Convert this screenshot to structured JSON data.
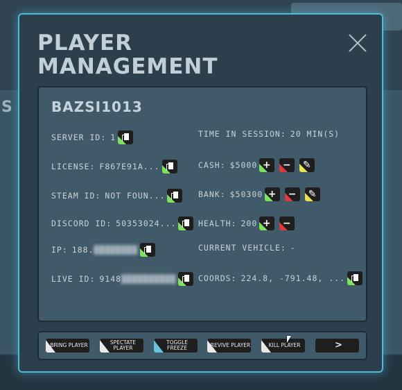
{
  "modal": {
    "title_line1": "PLAYER",
    "title_line2": "MANAGEMENT"
  },
  "background": {
    "left_letter": "S"
  },
  "player": {
    "name": "BAZSI1013",
    "left_fields": [
      {
        "label": "SERVER ID:",
        "value": "1",
        "blurred": false
      },
      {
        "label": "LICENSE:",
        "value": "F867E91A...",
        "blurred": false
      },
      {
        "label": "STEAM ID:",
        "value": "NOT FOUN...",
        "blurred": false
      },
      {
        "label": "DISCORD ID:",
        "value": "50353024...",
        "blurred": false
      },
      {
        "label": "IP:",
        "value": "188.",
        "blurred_value": "████████",
        "blurred": true
      },
      {
        "label": "LIVE ID:",
        "value": "9148",
        "blurred_value": "██████████",
        "blurred": true
      }
    ],
    "right_fields": {
      "time_label": "TIME IN SESSION:",
      "time_value": "20 MIN(S)",
      "cash_label": "CASH:",
      "cash_value": "$5000",
      "bank_label": "BANK:",
      "bank_value": "$50300",
      "health_label": "HEALTH:",
      "health_value": "200",
      "vehicle_label": "CURRENT VEHICLE:",
      "vehicle_value": "-",
      "coords_label": "COORDS:",
      "coords_value": "224.8, -791.48, ..."
    }
  },
  "icons": {
    "plus": "+",
    "minus": "−",
    "edit": "✎"
  },
  "actions": [
    {
      "label": "BRING PLAYER",
      "accent": "#7ee25c"
    },
    {
      "label": "SPECTATE PLAYER",
      "accent": "#7ee25c"
    },
    {
      "label": "TOGGLE FREEZE",
      "accent": "#63c4dc"
    },
    {
      "label": "REVIVE PLAYER",
      "accent": "#7ee25c"
    },
    {
      "label": "KILL PLAYER",
      "accent": "#e0383c"
    },
    {
      "label": ">",
      "accent": ""
    }
  ],
  "colors": {
    "modal_border": "#4fb9d6",
    "panel_bg": "#415a69",
    "accent_green": "#7ee25c",
    "accent_red": "#e0383c",
    "accent_yellow": "#e8e34e",
    "accent_cyan": "#63c4dc"
  }
}
